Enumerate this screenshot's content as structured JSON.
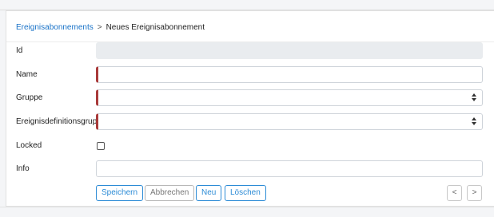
{
  "breadcrumb": {
    "parent": "Ereignisabonnements",
    "separator": ">",
    "current": "Neues Ereignisabonnement"
  },
  "form": {
    "id": {
      "label": "Id",
      "value": ""
    },
    "name": {
      "label": "Name",
      "value": "",
      "required": true
    },
    "gruppe": {
      "label": "Gruppe",
      "value": "",
      "required": true
    },
    "ereignisdefinitionsgruppe": {
      "label": "Ereignisdefinitionsgruppe",
      "value": "",
      "required": true
    },
    "locked": {
      "label": "Locked",
      "checked": false
    },
    "info": {
      "label": "Info",
      "value": ""
    }
  },
  "actions": {
    "save": "Speichern",
    "cancel": "Abbrechen",
    "new": "Neu",
    "delete": "Löschen",
    "prev": "<",
    "next": ">"
  },
  "colors": {
    "link": "#1a73c8",
    "primary_button": "#2d8cd6",
    "required_marker": "#a93a3a",
    "readonly_field": "#e9ecef"
  },
  "icons": {
    "select_caret": "updown-caret-icon"
  }
}
